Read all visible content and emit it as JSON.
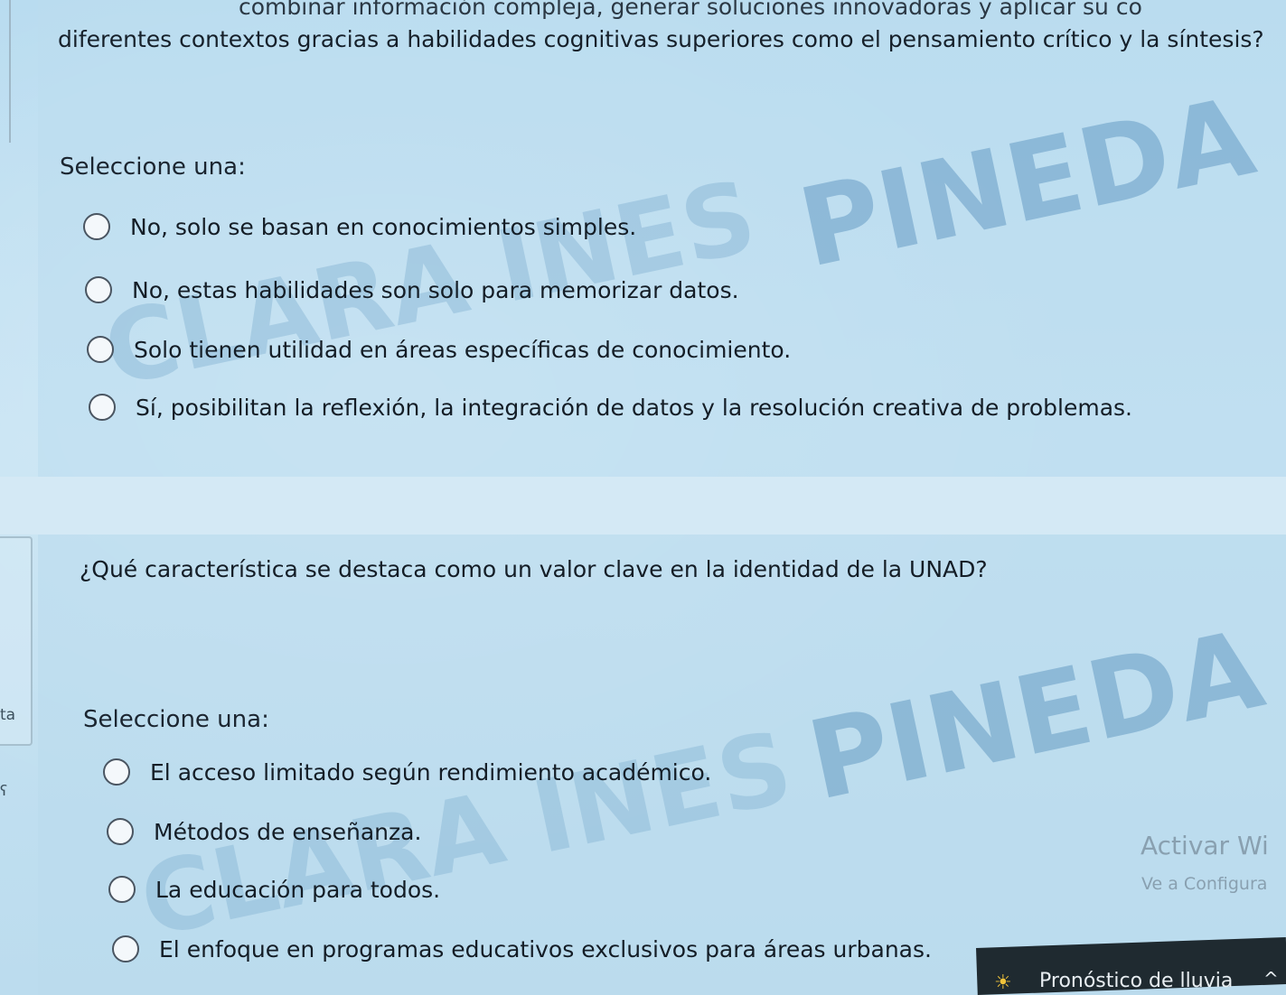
{
  "previous_question": {
    "line1": "combinar información compleja, generar soluciones innovadoras y aplicar su co",
    "line2": "diferentes contextos gracias a habilidades cognitivas superiores como el pensamiento crítico y la síntesis?",
    "select_label": "Seleccione una:",
    "options": [
      "No, solo se basan en conocimientos simples.",
      "No, estas habilidades son solo para memorizar datos.",
      "Solo tienen utilidad en áreas específicas de conocimiento.",
      "Sí, posibilitan la reflexión, la integración de datos y la resolución creativa de problemas."
    ]
  },
  "current_question": {
    "text": "¿Qué característica se destaca como un valor clave en la identidad de la UNAD?",
    "select_label": "Seleccione una:",
    "options": [
      "El acceso limitado según rendimiento académico.",
      "Métodos de enseñanza.",
      "La educación para todos.",
      "El enfoque en programas educativos exclusivos para áreas urbanas."
    ]
  },
  "sidebar": {
    "tab_label": "ta",
    "tab_mark": "ʕ"
  },
  "watermark": {
    "word1": "PINEDA BR",
    "word2": "CLARA INES"
  },
  "windows_activation": {
    "title": "Activar Wi",
    "subtitle": "Ve a Configura"
  },
  "taskbar": {
    "weather_text": "Pronóstico de lluvia",
    "weather_icon": "sun-rain-icon",
    "chevron_icon": "chevron-up-icon"
  }
}
